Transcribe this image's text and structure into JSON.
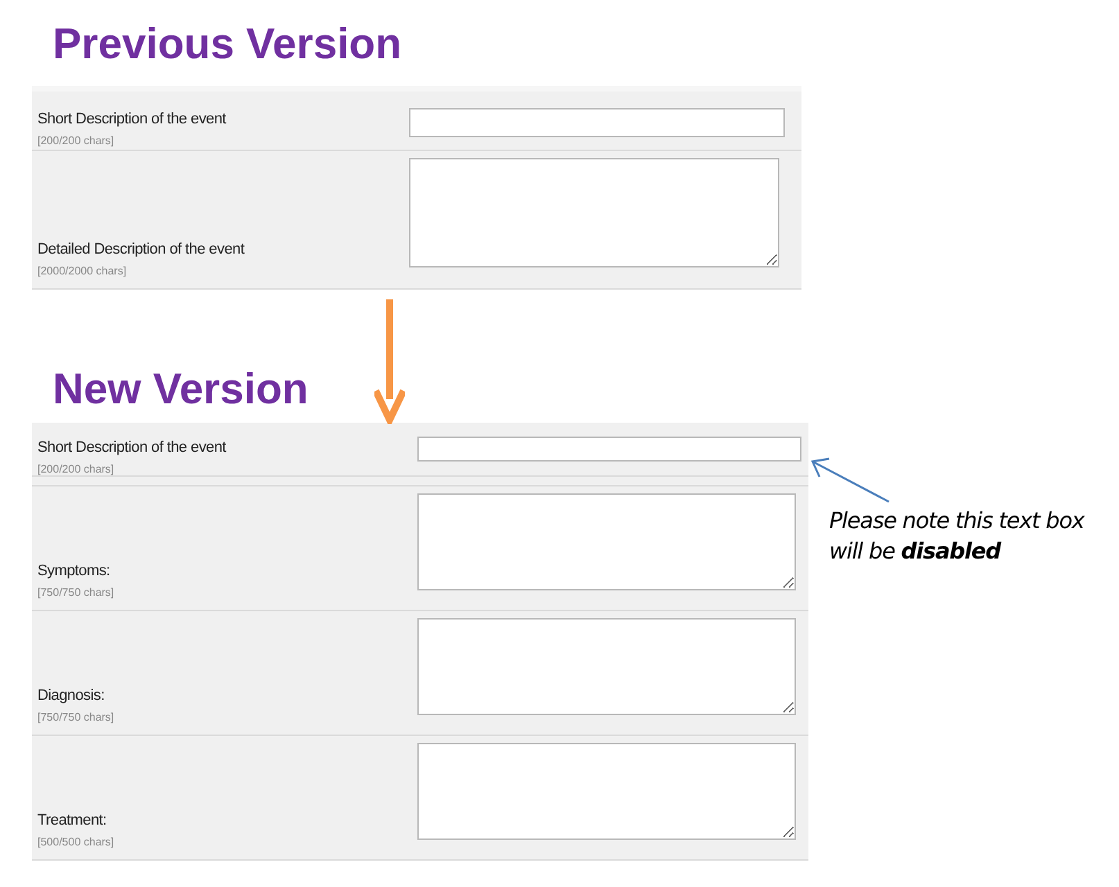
{
  "sections": [
    {
      "heading": "Previous Version",
      "rows": [
        {
          "kind": "input",
          "label": "Short Description of the event",
          "counter": "[200/200 chars]"
        },
        {
          "kind": "textarea",
          "label": "Detailed Description of the event",
          "counter": "[2000/2000 chars]"
        }
      ]
    },
    {
      "heading": "New Version",
      "rows": [
        {
          "kind": "input",
          "label": "Short Description of the event",
          "counter": "[200/200 chars]"
        },
        {
          "kind": "textarea",
          "label": "Symptoms:",
          "counter": "[750/750 chars]"
        },
        {
          "kind": "textarea",
          "label": "Diagnosis:",
          "counter": "[750/750 chars]"
        },
        {
          "kind": "textarea",
          "label": "Treatment:",
          "counter": "[500/500 chars]"
        }
      ]
    }
  ],
  "callout": {
    "lines": [
      "Please note this text box",
      "will be **disabled**"
    ]
  }
}
